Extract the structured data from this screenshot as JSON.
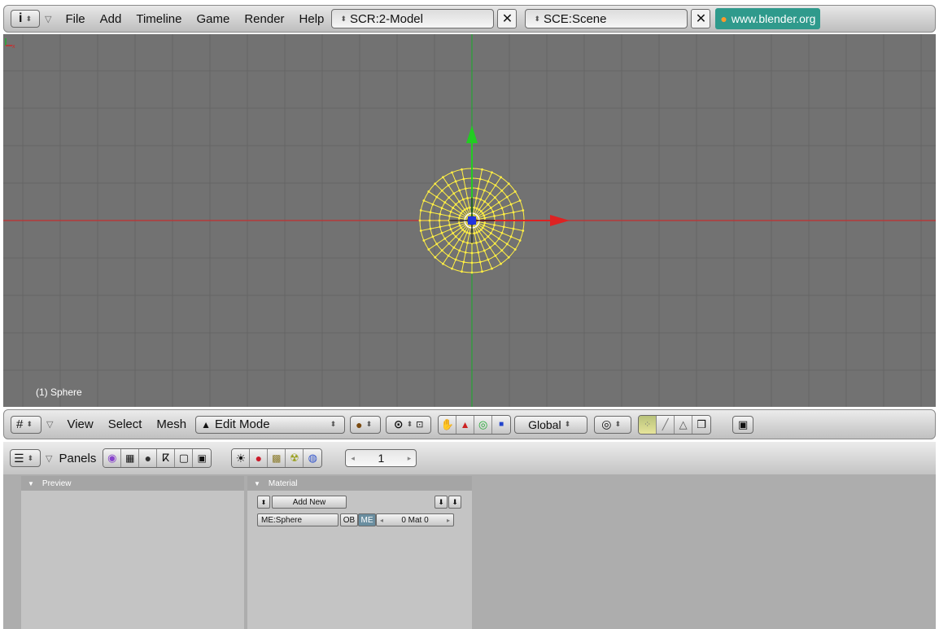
{
  "header": {
    "menus": [
      "File",
      "Add",
      "Timeline",
      "Game",
      "Render",
      "Help"
    ],
    "screen": "SCR:2-Model",
    "scene": "SCE:Scene",
    "website": "www.blender.org"
  },
  "viewport": {
    "object_label": "(1) Sphere",
    "background": "#727272",
    "x_axis_color": "#cc2a2a",
    "y_axis_color": "#22aa33",
    "mesh_color": "#ffee44"
  },
  "view_header": {
    "menus": [
      "View",
      "Select",
      "Mesh"
    ],
    "mode": "Edit Mode",
    "orientation": "Global"
  },
  "buttons_header": {
    "panels_label": "Panels",
    "frame": "1"
  },
  "panels": {
    "preview": {
      "title": "Preview"
    },
    "material": {
      "title": "Material",
      "add_new": "Add New",
      "mesh_name": "ME:Sphere",
      "ob": "OB",
      "me": "ME",
      "mat_count": "0 Mat 0"
    }
  }
}
